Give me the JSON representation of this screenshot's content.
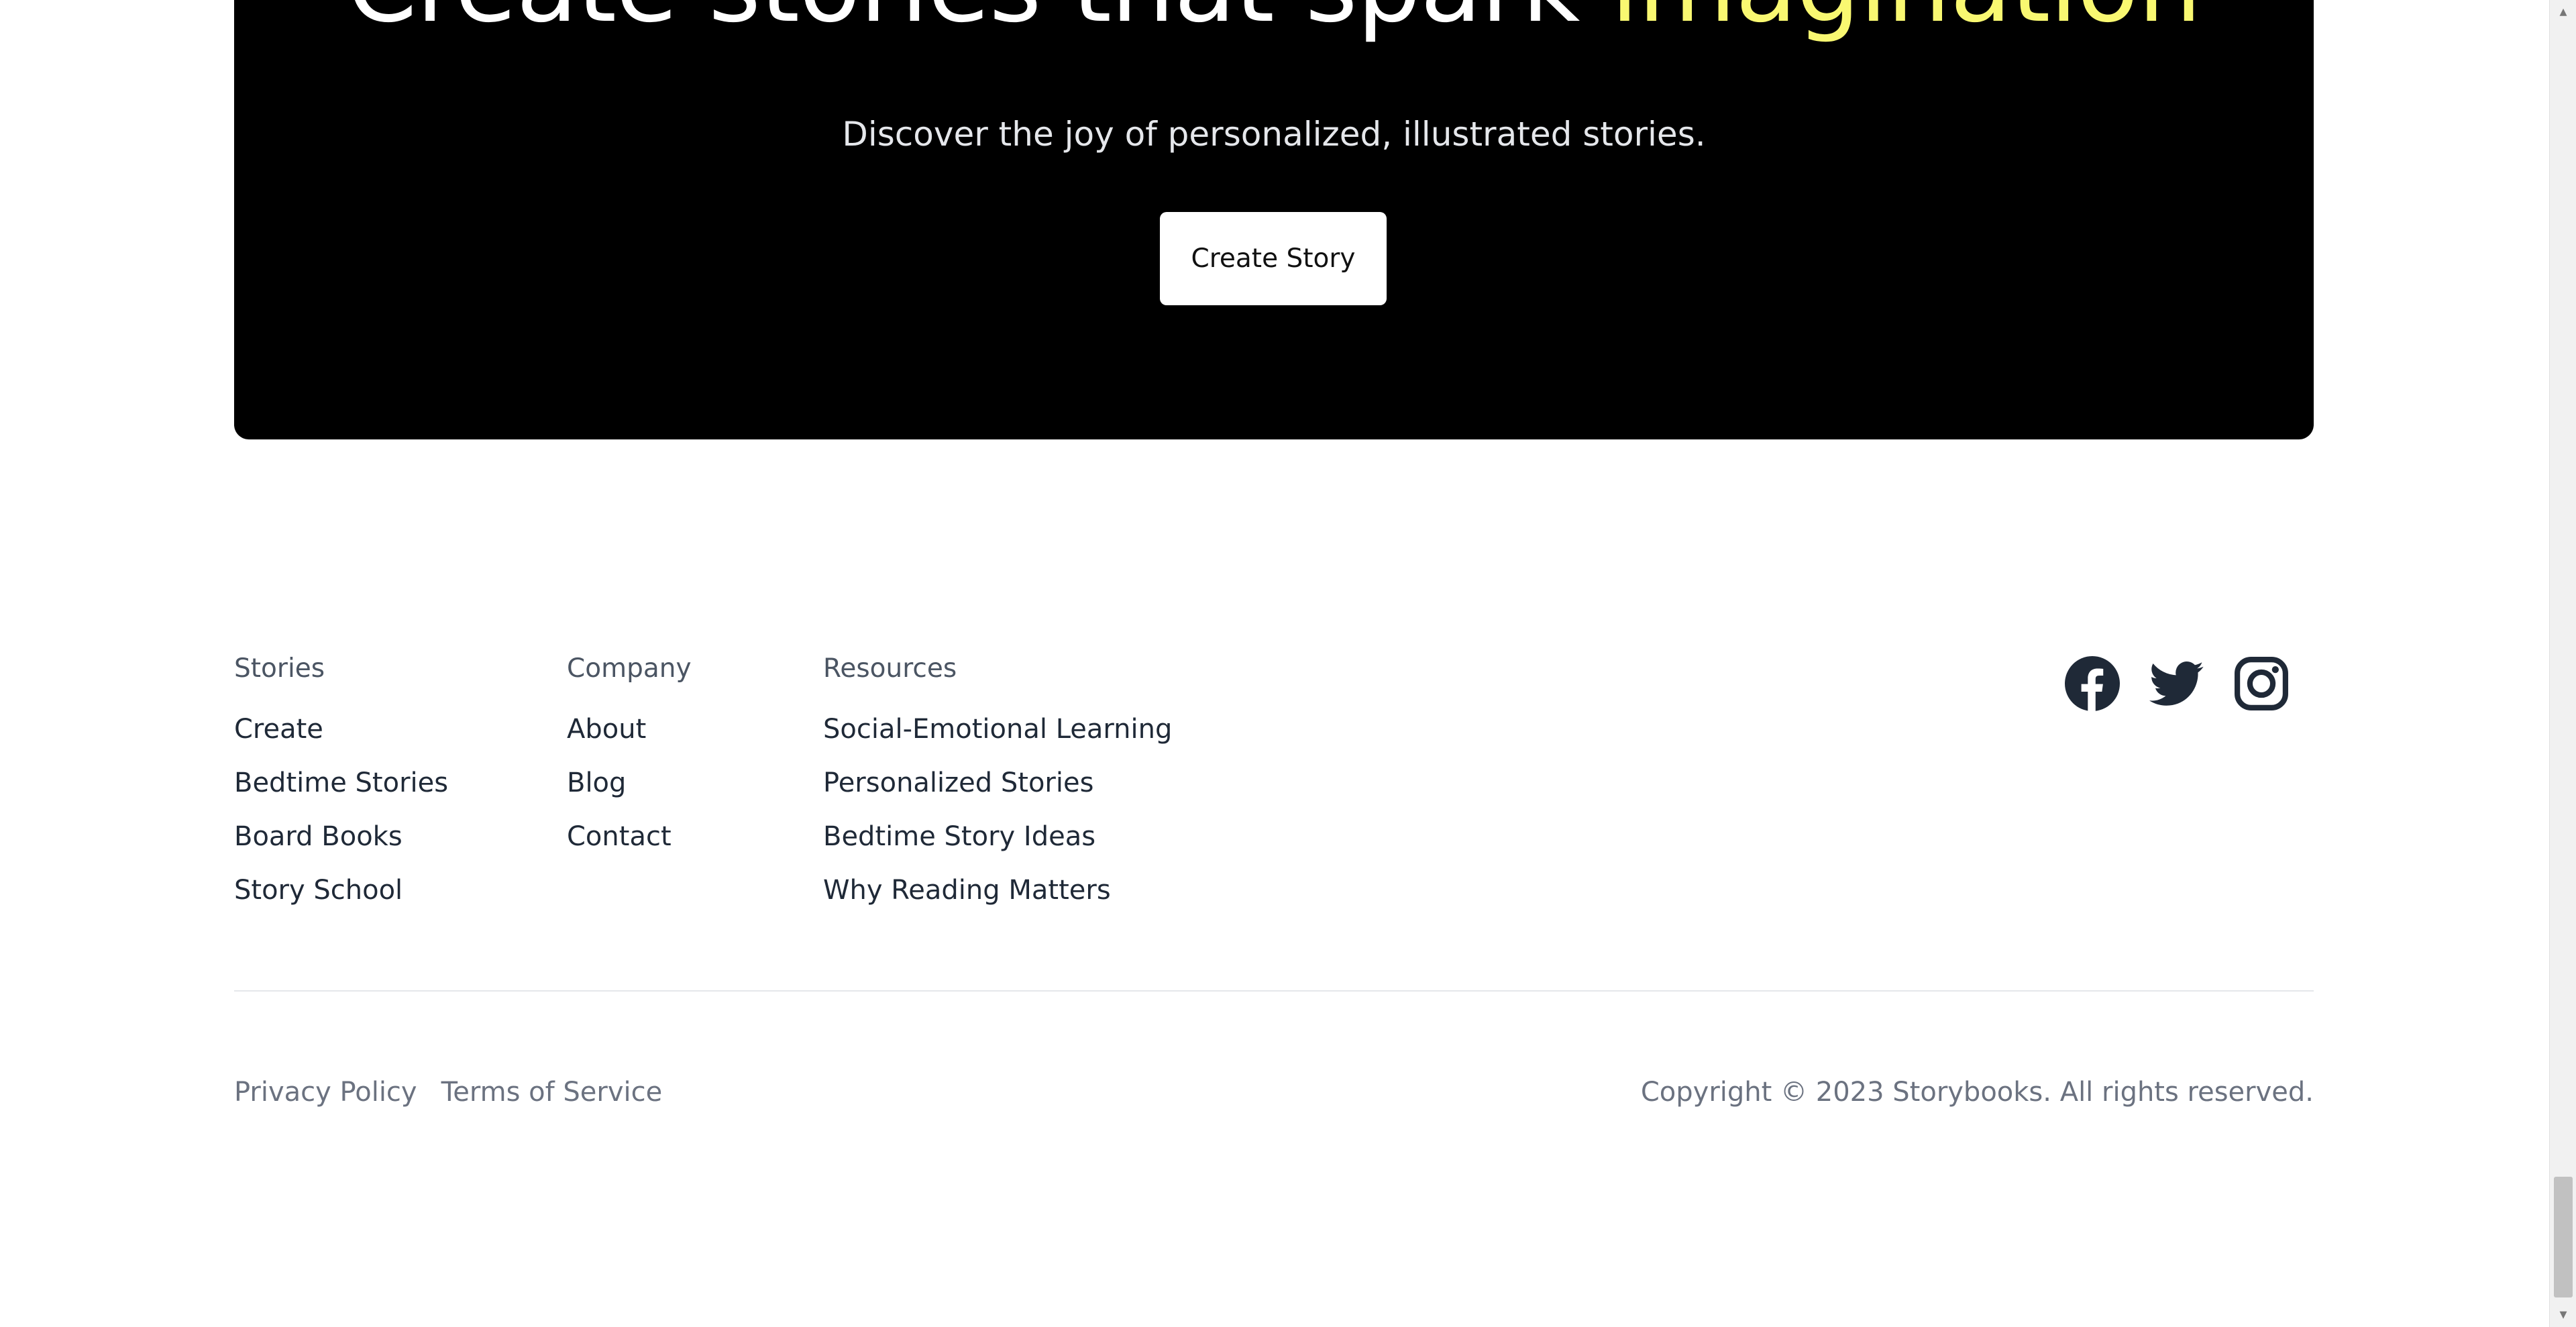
{
  "hero": {
    "title_main": "Create stories that spark ",
    "title_accent": "imagination",
    "subtitle": "Discover the joy of personalized, illustrated stories.",
    "cta_label": "Create Story",
    "accent_color": "#f9f871"
  },
  "footer": {
    "columns": [
      {
        "heading": "Stories",
        "links": [
          "Create",
          "Bedtime Stories",
          "Board Books",
          "Story School"
        ]
      },
      {
        "heading": "Company",
        "links": [
          "About",
          "Blog",
          "Contact"
        ]
      },
      {
        "heading": "Resources",
        "links": [
          "Social-Emotional Learning",
          "Personalized Stories",
          "Bedtime Story Ideas",
          "Why Reading Matters"
        ]
      }
    ],
    "social": [
      "facebook-icon",
      "twitter-icon",
      "instagram-icon"
    ],
    "legal": {
      "privacy": "Privacy Policy",
      "terms": "Terms of Service"
    },
    "copyright": "Copyright © 2023 Storybooks. All rights reserved."
  }
}
